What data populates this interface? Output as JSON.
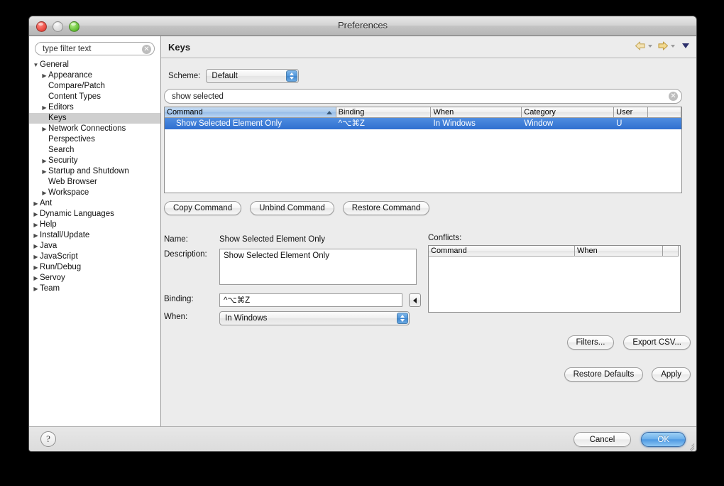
{
  "window": {
    "title": "Preferences",
    "traffic_lights": [
      "close-button",
      "minimize-button",
      "zoom-button"
    ]
  },
  "sidebar": {
    "filter": {
      "value": "",
      "placeholder": "type filter text",
      "clear_icon": "clear-icon"
    },
    "items": [
      {
        "label": "General",
        "indent": 0,
        "twisty": "down",
        "selected": false
      },
      {
        "label": "Appearance",
        "indent": 1,
        "twisty": "right",
        "selected": false
      },
      {
        "label": "Compare/Patch",
        "indent": 1,
        "twisty": "none",
        "selected": false
      },
      {
        "label": "Content Types",
        "indent": 1,
        "twisty": "none",
        "selected": false
      },
      {
        "label": "Editors",
        "indent": 1,
        "twisty": "right",
        "selected": false
      },
      {
        "label": "Keys",
        "indent": 1,
        "twisty": "none",
        "selected": true
      },
      {
        "label": "Network Connections",
        "indent": 1,
        "twisty": "right",
        "selected": false
      },
      {
        "label": "Perspectives",
        "indent": 1,
        "twisty": "none",
        "selected": false
      },
      {
        "label": "Search",
        "indent": 1,
        "twisty": "none",
        "selected": false
      },
      {
        "label": "Security",
        "indent": 1,
        "twisty": "right",
        "selected": false
      },
      {
        "label": "Startup and Shutdown",
        "indent": 1,
        "twisty": "right",
        "selected": false
      },
      {
        "label": "Web Browser",
        "indent": 1,
        "twisty": "none",
        "selected": false
      },
      {
        "label": "Workspace",
        "indent": 1,
        "twisty": "right",
        "selected": false
      },
      {
        "label": "Ant",
        "indent": 0,
        "twisty": "right",
        "selected": false
      },
      {
        "label": "Dynamic Languages",
        "indent": 0,
        "twisty": "right",
        "selected": false
      },
      {
        "label": "Help",
        "indent": 0,
        "twisty": "right",
        "selected": false
      },
      {
        "label": "Install/Update",
        "indent": 0,
        "twisty": "right",
        "selected": false
      },
      {
        "label": "Java",
        "indent": 0,
        "twisty": "right",
        "selected": false
      },
      {
        "label": "JavaScript",
        "indent": 0,
        "twisty": "right",
        "selected": false
      },
      {
        "label": "Run/Debug",
        "indent": 0,
        "twisty": "right",
        "selected": false
      },
      {
        "label": "Servoy",
        "indent": 0,
        "twisty": "right",
        "selected": false
      },
      {
        "label": "Team",
        "indent": 0,
        "twisty": "right",
        "selected": false
      }
    ]
  },
  "page": {
    "title": "Keys",
    "nav": {
      "back_icon": "back-arrow-icon",
      "back_menu_icon": "chevron-down-icon",
      "forward_icon": "forward-arrow-icon",
      "forward_menu_icon": "chevron-down-icon",
      "menu_icon": "view-menu-icon"
    },
    "scheme": {
      "label": "Scheme:",
      "value": "Default"
    },
    "search": {
      "value": "show selected",
      "placeholder": "type filter text",
      "clear_icon": "clear-icon"
    },
    "table": {
      "columns": [
        "Command",
        "Binding",
        "When",
        "Category",
        "User",
        ""
      ],
      "sorted_column": "Command",
      "sort_direction": "ascending",
      "rows": [
        {
          "command": "Show Selected Element Only",
          "binding": "^⌥⌘Z",
          "when": "In Windows",
          "category": "Window",
          "user": "U",
          "selected": true
        }
      ]
    },
    "command_buttons": [
      {
        "label": "Copy Command"
      },
      {
        "label": "Unbind Command"
      },
      {
        "label": "Restore Command"
      }
    ],
    "details": {
      "name_label": "Name:",
      "name_value": "Show Selected Element Only",
      "description_label": "Description:",
      "description_value": "Show Selected Element Only",
      "binding_label": "Binding:",
      "binding_value": "^⌥⌘Z",
      "binding_button_icon": "left-triangle-icon",
      "when_label": "When:",
      "when_value": "In Windows"
    },
    "conflicts": {
      "label": "Conflicts:",
      "columns": [
        "Command",
        "When",
        ""
      ],
      "rows": []
    },
    "lower_buttons_row1": [
      {
        "label": "Filters..."
      },
      {
        "label": "Export CSV..."
      }
    ],
    "lower_buttons_row2": [
      {
        "label": "Restore Defaults"
      },
      {
        "label": "Apply"
      }
    ]
  },
  "footer": {
    "help_icon": "help-icon",
    "help_label": "?",
    "cancel_label": "Cancel",
    "ok_label": "OK",
    "resize_grip": "resize-grip-icon"
  },
  "colors": {
    "selection_blue": "#2f6fd0",
    "header_sorted_blue": "#a9c9ec",
    "default_button_blue": "#6fb2ec",
    "window_bg": "#ececec"
  }
}
